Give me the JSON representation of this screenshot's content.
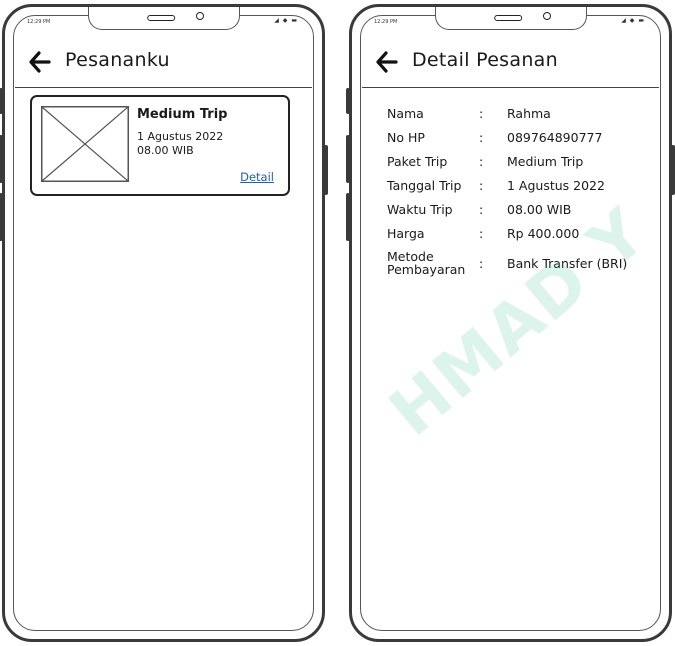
{
  "left_screen": {
    "status_time": "12:29 PM",
    "status_icons": "◢ ◆ ▬",
    "title": "Pesananku",
    "order": {
      "name": "Medium Trip",
      "date": "1 Agustus 2022",
      "time": "08.00 WIB",
      "detail_link": "Detail"
    }
  },
  "right_screen": {
    "status_time": "12:29 PM",
    "status_icons": "◢ ◆ ▬",
    "title": "Detail Pesanan",
    "separator": ":",
    "rows": [
      {
        "label": "Nama",
        "value": "Rahma"
      },
      {
        "label": "No HP",
        "value": "089764890777"
      },
      {
        "label": "Paket Trip",
        "value": "Medium Trip"
      },
      {
        "label": "Tanggal Trip",
        "value": "1 Agustus 2022"
      },
      {
        "label": "Waktu Trip",
        "value": "08.00 WIB"
      },
      {
        "label": "Harga",
        "value": "Rp 400.000"
      },
      {
        "label": "Metode Pembayaran",
        "value": "Bank Transfer (BRI)"
      }
    ]
  },
  "watermark": "HMAD Y",
  "icons": {
    "back": "arrow-left-icon",
    "thumbnail": "image-placeholder-icon"
  }
}
